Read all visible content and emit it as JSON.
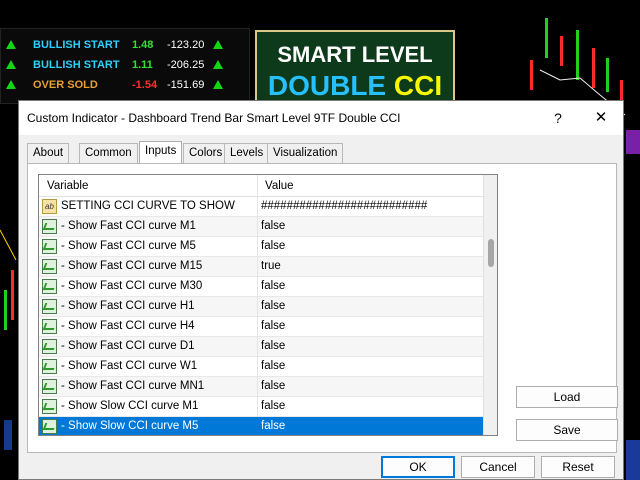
{
  "dashboard": {
    "rows": [
      {
        "label": "BULLISH START",
        "label_color": "#2ed0ff",
        "v1": "1.48",
        "v1_color": "#33e033",
        "v2": "-123.20"
      },
      {
        "label": "BULLISH START",
        "label_color": "#2ed0ff",
        "v1": "1.11",
        "v1_color": "#33e033",
        "v2": "-206.25"
      },
      {
        "label": "OVER SOLD",
        "label_color": "#e8a033",
        "v1": "-1.54",
        "v1_color": "#ff3030",
        "v2": "-151.69"
      }
    ]
  },
  "smart_box": {
    "line1": "SMART LEVEL",
    "line2a": "DOUBLE",
    "line2b": "CCI"
  },
  "dialog": {
    "title": "Custom Indicator - Dashboard Trend Bar Smart Level 9TF Double CCI",
    "help_glyph": "?",
    "close_glyph": "✕",
    "tabs": [
      "About",
      "Common",
      "Inputs",
      "Colors",
      "Levels",
      "Visualization"
    ],
    "active_tab": "Inputs",
    "grid": {
      "col_variable": "Variable",
      "col_value": "Value",
      "rows": [
        {
          "icon": "ab-icon",
          "icon_text": "ab",
          "name": "SETTING CCI CURVE TO SHOW",
          "value": "##########################",
          "selected": false
        },
        {
          "icon": "bool-icon",
          "name": "- Show Fast CCI curve M1",
          "value": "false",
          "selected": false
        },
        {
          "icon": "bool-icon",
          "name": "- Show Fast CCI curve M5",
          "value": "false",
          "selected": false
        },
        {
          "icon": "bool-icon",
          "name": "- Show Fast CCI curve M15",
          "value": "true",
          "selected": false
        },
        {
          "icon": "bool-icon",
          "name": "- Show Fast CCI curve M30",
          "value": "false",
          "selected": false
        },
        {
          "icon": "bool-icon",
          "name": "- Show Fast CCI curve H1",
          "value": "false",
          "selected": false
        },
        {
          "icon": "bool-icon",
          "name": "- Show Fast CCI curve H4",
          "value": "false",
          "selected": false
        },
        {
          "icon": "bool-icon",
          "name": "- Show Fast CCI curve D1",
          "value": "false",
          "selected": false
        },
        {
          "icon": "bool-icon",
          "name": "- Show Fast CCI curve W1",
          "value": "false",
          "selected": false
        },
        {
          "icon": "bool-icon",
          "name": "- Show Fast CCI curve MN1",
          "value": "false",
          "selected": false
        },
        {
          "icon": "bool-icon",
          "name": "- Show Slow CCI curve M1",
          "value": "false",
          "selected": false
        },
        {
          "icon": "bool-icon",
          "name": "- Show Slow CCI curve M5",
          "value": "false",
          "selected": true
        }
      ]
    },
    "buttons": {
      "load": "Load",
      "save": "Save",
      "ok": "OK",
      "cancel": "Cancel",
      "reset": "Reset"
    }
  },
  "colors": {
    "selection": "#0078d7",
    "bull_green": "#15d615"
  }
}
